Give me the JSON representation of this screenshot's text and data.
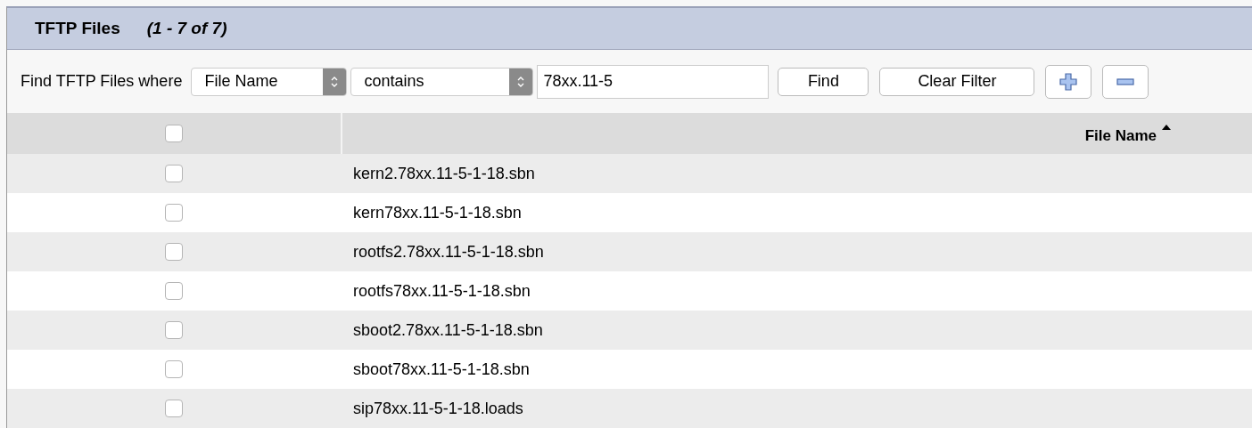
{
  "panel": {
    "title": "TFTP Files",
    "count": "(1 - 7 of 7)"
  },
  "filter": {
    "label": "Find TFTP Files where",
    "field": "File Name",
    "operator": "contains",
    "value": "78xx.11-5",
    "buttons": [
      "Find",
      "Clear Filter"
    ]
  },
  "table": {
    "select_all_checked": false,
    "columns": [
      {
        "label": "File Name",
        "sorted": true
      }
    ],
    "rows": [
      {
        "checked": false,
        "name": "kern2.78xx.11-5-1-18.sbn"
      },
      {
        "checked": false,
        "name": "kern78xx.11-5-1-18.sbn"
      },
      {
        "checked": false,
        "name": "rootfs2.78xx.11-5-1-18.sbn"
      },
      {
        "checked": false,
        "name": "rootfs78xx.11-5-1-18.sbn"
      },
      {
        "checked": false,
        "name": "sboot2.78xx.11-5-1-18.sbn"
      },
      {
        "checked": false,
        "name": "sboot78xx.11-5-1-18.sbn"
      },
      {
        "checked": false,
        "name": "sip78xx.11-5-1-18.loads"
      }
    ]
  }
}
